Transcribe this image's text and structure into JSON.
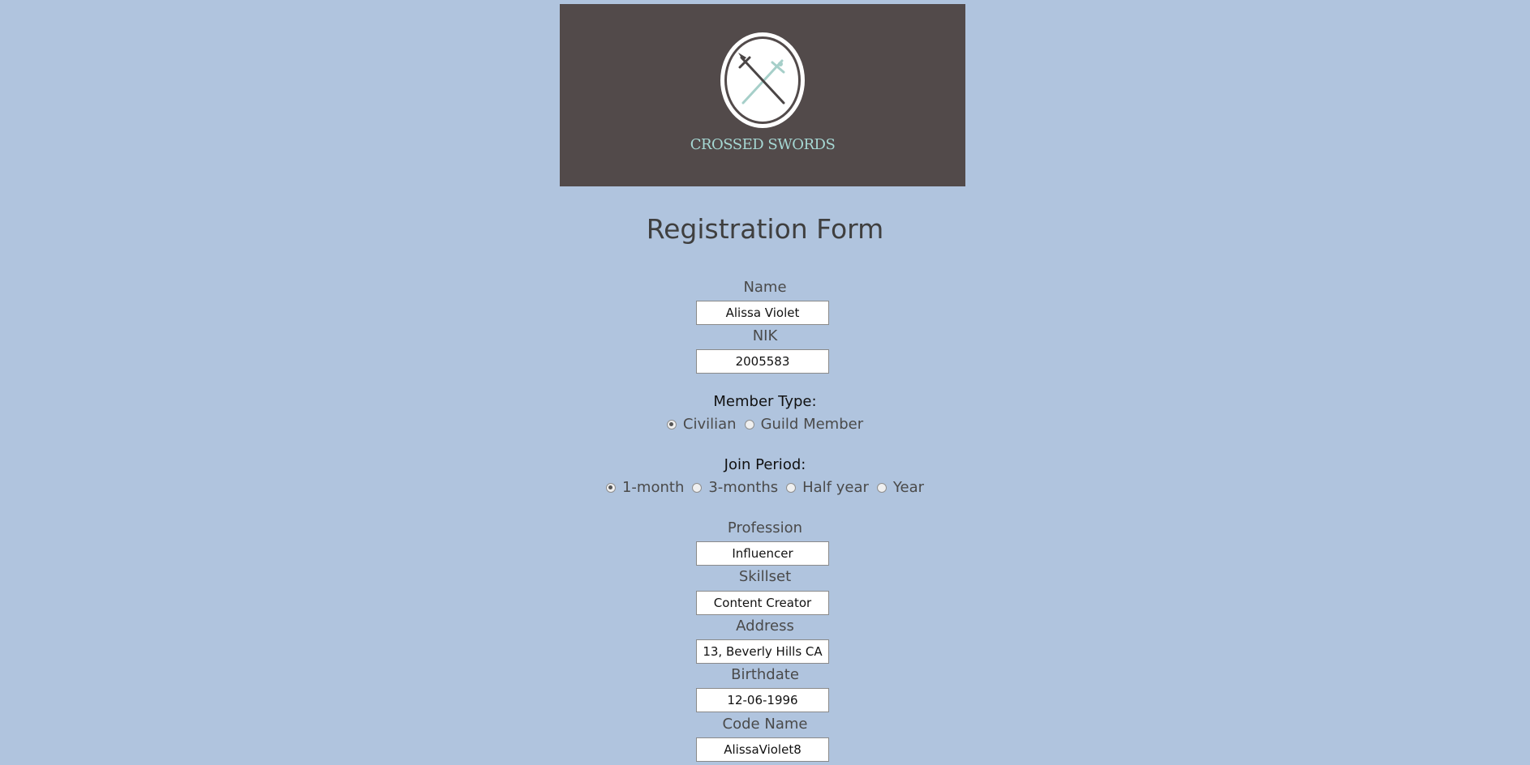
{
  "banner": {
    "brand": "CROSSED SWORDS"
  },
  "form": {
    "title": "Registration Form",
    "fields": {
      "name": {
        "label": "Name",
        "value": "Alissa Violet"
      },
      "nik": {
        "label": "NIK",
        "value": "2005583"
      },
      "profession": {
        "label": "Profession",
        "value": "Influencer"
      },
      "skillset": {
        "label": "Skillset",
        "value": "Content Creator"
      },
      "address": {
        "label": "Address",
        "value": "13, Beverly Hills CA"
      },
      "birthdate": {
        "label": "Birthdate",
        "value": "12-06-1996"
      },
      "codename": {
        "label": "Code Name",
        "value": "AlissaViolet8"
      }
    },
    "member_type": {
      "label": "Member Type:",
      "selected": "Civilian",
      "options": [
        "Civilian",
        "Guild Member"
      ]
    },
    "join_period": {
      "label": "Join Period:",
      "selected": "1-month",
      "options": [
        "1-month",
        "3-months",
        "Half year",
        "Year"
      ]
    }
  },
  "colors": {
    "background": "#b0c4de",
    "banner": "#524a4a",
    "brand_text": "#a6d8d4"
  },
  "icons": {
    "logo": "crossed-swords-emblem-icon"
  }
}
